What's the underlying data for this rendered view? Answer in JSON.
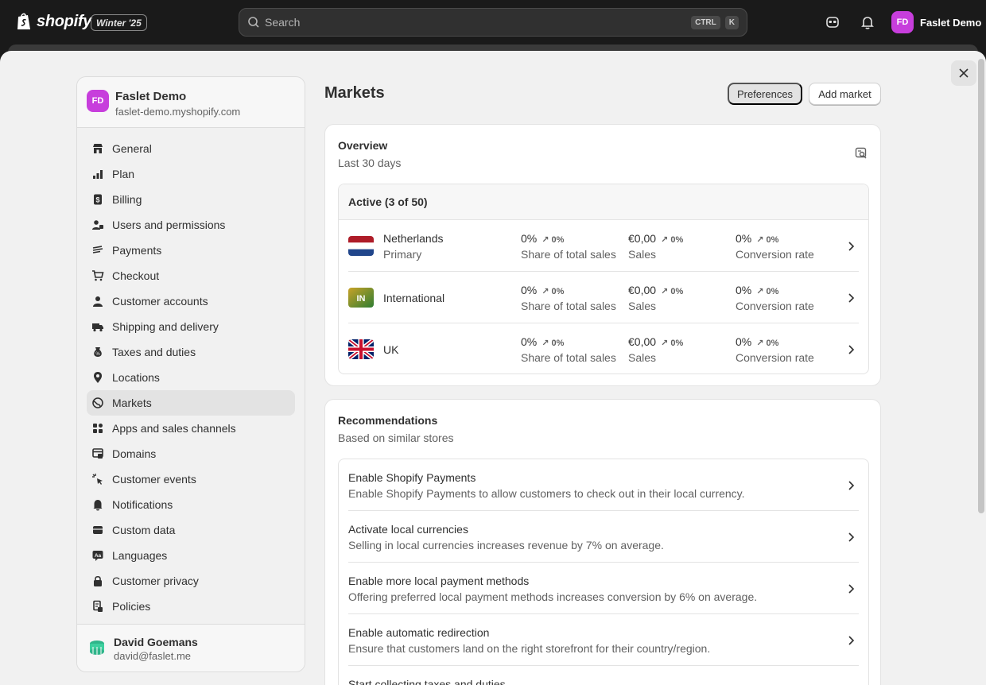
{
  "topbar": {
    "logo_text": "shopify",
    "edition_badge": "Winter '25",
    "search_placeholder": "Search",
    "shortcut_keys": [
      "CTRL",
      "K"
    ],
    "user_initials": "FD",
    "user_name": "Faslet Demo"
  },
  "sidebar": {
    "store_initials": "FD",
    "store_name": "Faslet Demo",
    "store_domain": "faslet-demo.myshopify.com",
    "items": [
      {
        "label": "General",
        "icon": "store-icon"
      },
      {
        "label": "Plan",
        "icon": "plan-icon"
      },
      {
        "label": "Billing",
        "icon": "billing-icon"
      },
      {
        "label": "Users and permissions",
        "icon": "users-icon"
      },
      {
        "label": "Payments",
        "icon": "payments-icon"
      },
      {
        "label": "Checkout",
        "icon": "cart-icon"
      },
      {
        "label": "Customer accounts",
        "icon": "person-icon"
      },
      {
        "label": "Shipping and delivery",
        "icon": "truck-icon"
      },
      {
        "label": "Taxes and duties",
        "icon": "tax-icon"
      },
      {
        "label": "Locations",
        "icon": "location-pin-icon"
      },
      {
        "label": "Markets",
        "icon": "globe-icon",
        "active": true
      },
      {
        "label": "Apps and sales channels",
        "icon": "apps-icon"
      },
      {
        "label": "Domains",
        "icon": "domains-icon"
      },
      {
        "label": "Customer events",
        "icon": "cursor-click-icon"
      },
      {
        "label": "Notifications",
        "icon": "bell-icon"
      },
      {
        "label": "Custom data",
        "icon": "custom-data-icon"
      },
      {
        "label": "Languages",
        "icon": "language-icon"
      },
      {
        "label": "Customer privacy",
        "icon": "lock-icon"
      },
      {
        "label": "Policies",
        "icon": "policies-icon"
      }
    ],
    "footer_user_name": "David Goemans",
    "footer_user_email": "david@faslet.me"
  },
  "main": {
    "title": "Markets",
    "preferences_label": "Preferences",
    "add_market_label": "Add market",
    "overview": {
      "title": "Overview",
      "subtitle": "Last 30 days",
      "active_header": "Active (3 of 50)",
      "markets": [
        {
          "name": "Netherlands",
          "sub": "Primary",
          "share": "0%",
          "share_chg": "0%",
          "sales": "€0,00",
          "sales_chg": "0%",
          "conv": "0%",
          "conv_chg": "0%"
        },
        {
          "name": "International",
          "sub": "",
          "badge": "IN",
          "share": "0%",
          "share_chg": "0%",
          "sales": "€0,00",
          "sales_chg": "0%",
          "conv": "0%",
          "conv_chg": "0%"
        },
        {
          "name": "UK",
          "sub": "",
          "share": "0%",
          "share_chg": "0%",
          "sales": "€0,00",
          "sales_chg": "0%",
          "conv": "0%",
          "conv_chg": "0%"
        }
      ],
      "metric_labels": {
        "share": "Share of total sales",
        "sales": "Sales",
        "conv": "Conversion rate"
      }
    },
    "recommendations": {
      "title": "Recommendations",
      "subtitle": "Based on similar stores",
      "items": [
        {
          "title": "Enable Shopify Payments",
          "desc": "Enable Shopify Payments to allow customers to check out in their local currency."
        },
        {
          "title": "Activate local currencies",
          "desc": "Selling in local currencies increases revenue by 7% on average."
        },
        {
          "title": "Enable more local payment methods",
          "desc": "Offering preferred local payment methods increases conversion by 6% on average."
        },
        {
          "title": "Enable automatic redirection",
          "desc": "Ensure that customers land on the right storefront for their country/region."
        },
        {
          "title": "Start collecting taxes and duties",
          "desc": ""
        }
      ]
    }
  },
  "colors": {
    "brand_avatar": "#c73edc",
    "topbar": "#1a1a1a",
    "sheet": "#f1f1f1"
  }
}
